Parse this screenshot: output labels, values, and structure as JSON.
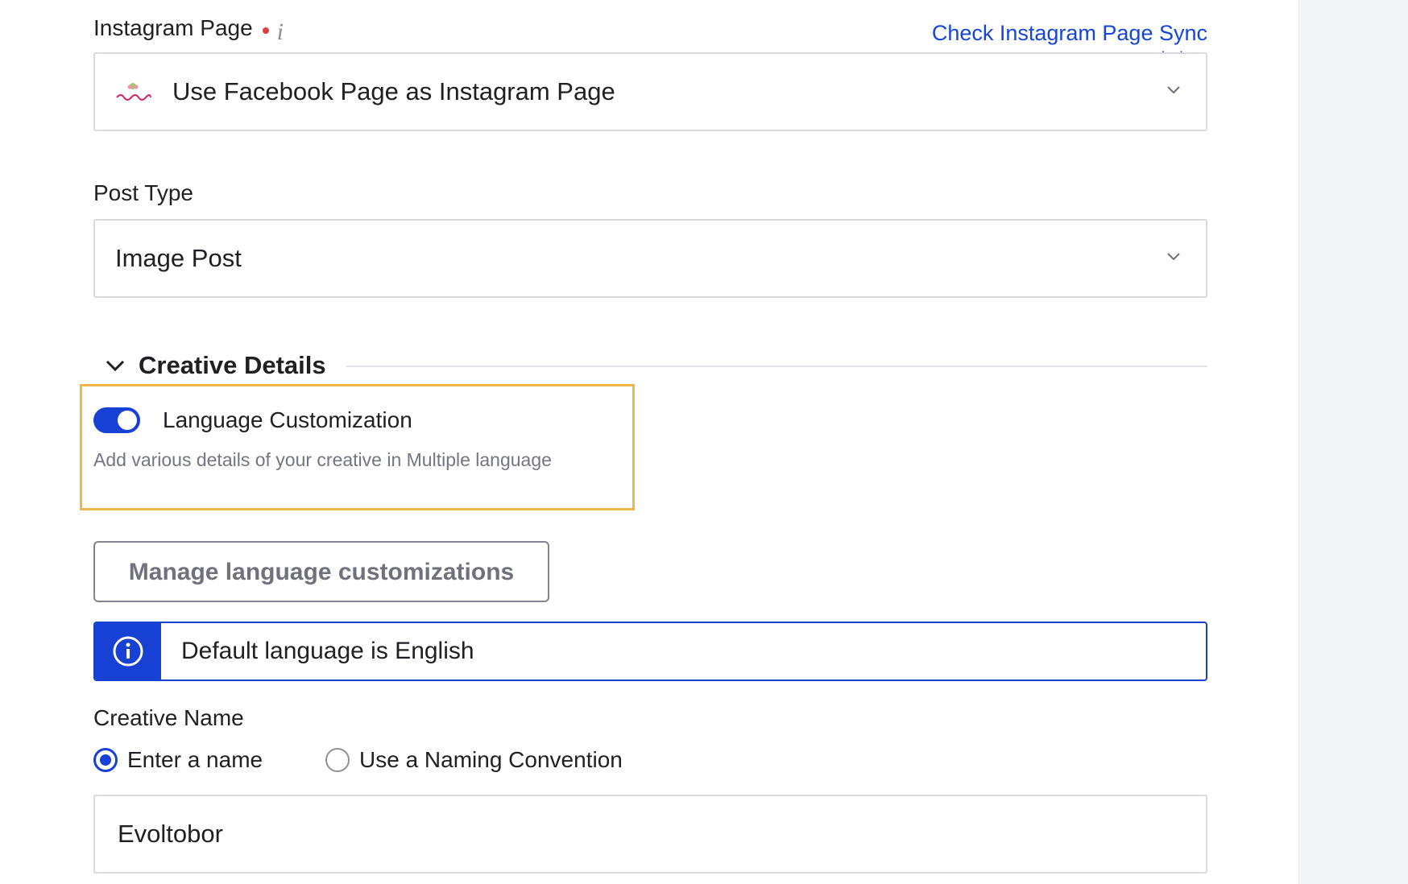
{
  "instagram_page": {
    "label": "Instagram Page",
    "info_icon": "i",
    "sync_link": "Check Instagram Page Sync status",
    "selected": "Use Facebook Page as Instagram Page"
  },
  "post_type": {
    "label": "Post Type",
    "selected": "Image Post"
  },
  "creative_details": {
    "title": "Creative Details",
    "language_customization": {
      "label": "Language Customization",
      "enabled": true,
      "helper": "Add various details of your creative in Multiple language"
    },
    "manage_button": "Manage language customizations",
    "banner": {
      "text": "Default language is English"
    },
    "creative_name": {
      "label": "Creative Name",
      "options": [
        {
          "label": "Enter a name",
          "selected": true
        },
        {
          "label": "Use a Naming Convention",
          "selected": false
        }
      ],
      "value": "Evoltobor"
    }
  },
  "colors": {
    "primary": "#1740d4",
    "link": "#1646d6",
    "highlight": "#f1b64b",
    "required": "#d93f3f"
  }
}
